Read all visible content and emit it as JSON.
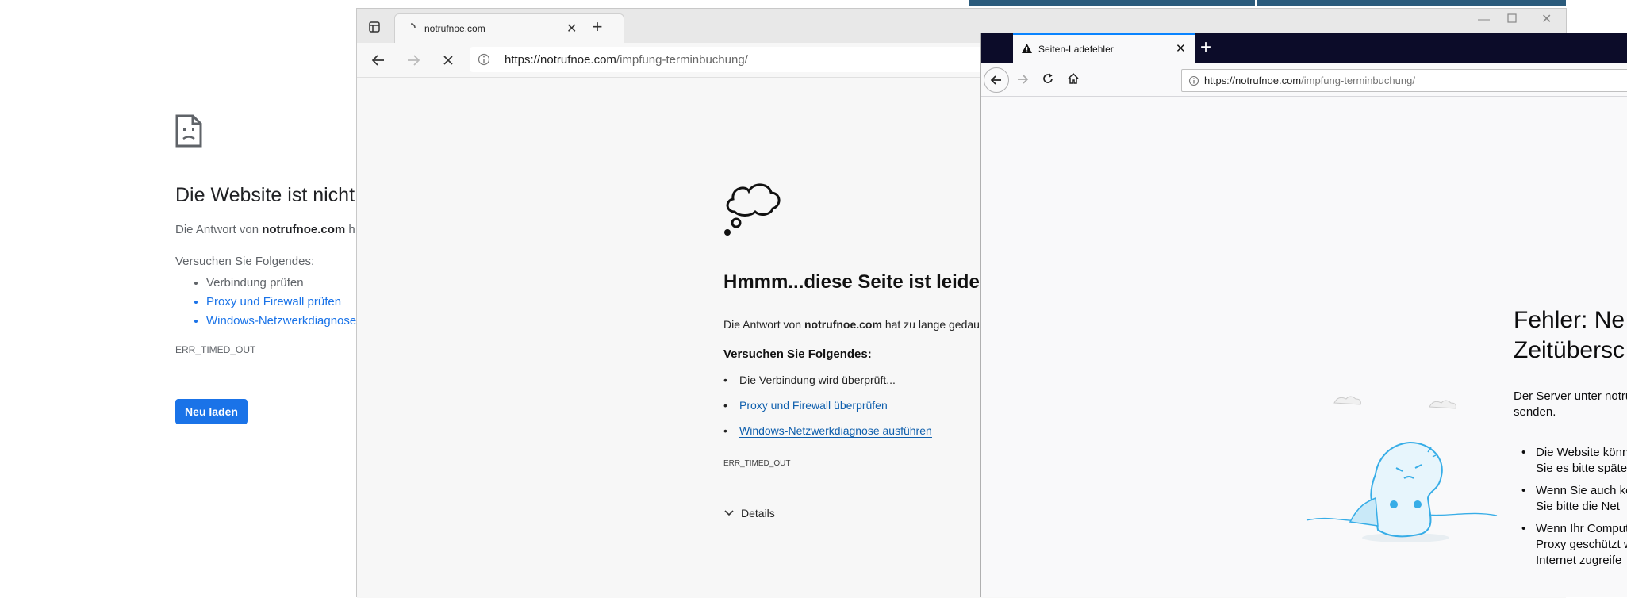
{
  "chrome_page": {
    "title": "Die Website ist nicht",
    "subtitle_prefix": "Die Antwort von ",
    "subtitle_domain": "notrufnoe.com",
    "subtitle_suffix": " h",
    "try_heading": "Versuchen Sie Folgendes:",
    "items": [
      "Verbindung prüfen",
      "Proxy und Firewall prüfen",
      "Windows-Netzwerkdiagnose"
    ],
    "error_code": "ERR_TIMED_OUT",
    "reload_label": "Neu laden"
  },
  "edge": {
    "tab_title": "notrufnoe.com",
    "url_host": "https://notrufnoe.com",
    "url_path": "/impfung-terminbuchung/",
    "heading": "Hmmm...diese Seite ist leider",
    "message_prefix": "Die Antwort von ",
    "message_domain": "notrufnoe.com",
    "message_suffix": " hat zu lange gedau",
    "try_heading": "Versuchen Sie Folgendes:",
    "items": [
      "Die Verbindung wird überprüft...",
      "Proxy und Firewall überprüfen",
      "Windows-Netzwerkdiagnose ausführen"
    ],
    "error_code": "ERR_TIMED_OUT",
    "details_label": "Details"
  },
  "firefox": {
    "tab_title": "Seiten-Ladefehler",
    "url_host": "https://notrufnoe.com",
    "url_path": "/impfung-terminbuchung/",
    "heading_line1": "Fehler: Ne",
    "heading_line2": "Zeitübersc",
    "desc_line1": "Der Server unter notru",
    "desc_line2": "senden.",
    "bullets": [
      [
        "Die Website könn",
        "Sie es bitte späte"
      ],
      [
        "Wenn Sie auch ke",
        "Sie bitte die Net"
      ],
      [
        "Wenn Ihr Comput",
        "Proxy geschützt w",
        "Internet zugreife"
      ]
    ]
  },
  "colors": {
    "chrome_blue": "#1a73e8",
    "firefox_dark": "#0c0c29",
    "firefox_accent": "#0a84ff",
    "dino_blue": "#37ade7"
  }
}
